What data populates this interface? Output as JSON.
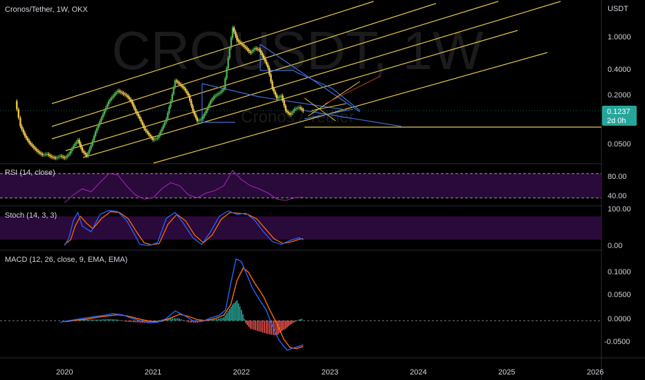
{
  "header": {
    "symbol_title": "Cronos/Tether, 1W, OKX",
    "currency": "USDT",
    "watermark_symbol": "CROUSDT, 1W",
    "watermark_name": "Cronos / Tether"
  },
  "colors": {
    "background": "#000000",
    "text": "#d1d4dc",
    "up": "#4caf50",
    "down": "#f2c94c",
    "channel": "#e6c84a",
    "wedge": "#3f6fd8",
    "rsi": "#9c27b0",
    "band_fill": "#2a0a3a",
    "macd": "#2962ff",
    "signal": "#ff6d00",
    "hist_pos": "#26a69a",
    "hist_neg": "#ef5350",
    "price_tag": "#26a69a",
    "accent_red": "#c0392b"
  },
  "chart_data": {
    "type": "candlestick",
    "timeframe": "1W",
    "exchange": "OKX",
    "x_axis": {
      "labels": [
        "2020",
        "2021",
        "2022",
        "2023",
        "2024",
        "2025",
        "2026"
      ],
      "range": [
        2019.27,
        2026.07
      ]
    },
    "price": {
      "scale": "log",
      "ylim": [
        0.036,
        1.5
      ],
      "tick_labels": [
        "1.0000",
        "0.4000",
        "0.2000",
        "0.0500"
      ],
      "last_price": "0.1237",
      "countdown": "2d 0h",
      "closes": [
        [
          2019.44,
          0.15
        ],
        [
          2019.5,
          0.085
        ],
        [
          2019.55,
          0.068
        ],
        [
          2019.6,
          0.058
        ],
        [
          2019.65,
          0.052
        ],
        [
          2019.7,
          0.047
        ],
        [
          2019.75,
          0.044
        ],
        [
          2019.8,
          0.045
        ],
        [
          2019.85,
          0.042
        ],
        [
          2019.9,
          0.041
        ],
        [
          2019.95,
          0.043
        ],
        [
          2020.0,
          0.041
        ],
        [
          2020.05,
          0.045
        ],
        [
          2020.1,
          0.054
        ],
        [
          2020.15,
          0.062
        ],
        [
          2020.2,
          0.048
        ],
        [
          2020.25,
          0.043
        ],
        [
          2020.3,
          0.055
        ],
        [
          2020.35,
          0.075
        ],
        [
          2020.4,
          0.095
        ],
        [
          2020.45,
          0.12
        ],
        [
          2020.5,
          0.15
        ],
        [
          2020.55,
          0.17
        ],
        [
          2020.6,
          0.19
        ],
        [
          2020.65,
          0.18
        ],
        [
          2020.7,
          0.17
        ],
        [
          2020.75,
          0.15
        ],
        [
          2020.8,
          0.12
        ],
        [
          2020.85,
          0.1
        ],
        [
          2020.9,
          0.08
        ],
        [
          2020.95,
          0.07
        ],
        [
          2021.0,
          0.062
        ],
        [
          2021.05,
          0.065
        ],
        [
          2021.1,
          0.08
        ],
        [
          2021.15,
          0.1
        ],
        [
          2021.2,
          0.15
        ],
        [
          2021.25,
          0.24
        ],
        [
          2021.3,
          0.22
        ],
        [
          2021.35,
          0.2
        ],
        [
          2021.4,
          0.17
        ],
        [
          2021.45,
          0.12
        ],
        [
          2021.5,
          0.095
        ],
        [
          2021.55,
          0.1
        ],
        [
          2021.6,
          0.12
        ],
        [
          2021.65,
          0.15
        ],
        [
          2021.7,
          0.17
        ],
        [
          2021.75,
          0.18
        ],
        [
          2021.8,
          0.2
        ],
        [
          2021.85,
          0.4
        ],
        [
          2021.9,
          0.8
        ],
        [
          2021.95,
          0.6
        ],
        [
          2022.0,
          0.55
        ],
        [
          2022.05,
          0.5
        ],
        [
          2022.1,
          0.45
        ],
        [
          2022.15,
          0.5
        ],
        [
          2022.2,
          0.48
        ],
        [
          2022.25,
          0.4
        ],
        [
          2022.3,
          0.32
        ],
        [
          2022.35,
          0.2
        ],
        [
          2022.4,
          0.16
        ],
        [
          2022.45,
          0.17
        ],
        [
          2022.5,
          0.12
        ],
        [
          2022.55,
          0.11
        ],
        [
          2022.6,
          0.125
        ],
        [
          2022.65,
          0.13
        ],
        [
          2022.7,
          0.12
        ]
      ]
    },
    "rsi": {
      "label": "RSI (14, close)",
      "band": [
        40,
        80
      ],
      "ylim": [
        28,
        95
      ],
      "tick_labels": [
        "80.00",
        "40.00"
      ],
      "values": [
        [
          2020.0,
          32
        ],
        [
          2020.1,
          45
        ],
        [
          2020.2,
          55
        ],
        [
          2020.3,
          50
        ],
        [
          2020.4,
          65
        ],
        [
          2020.5,
          80
        ],
        [
          2020.6,
          78
        ],
        [
          2020.7,
          60
        ],
        [
          2020.8,
          45
        ],
        [
          2020.9,
          38
        ],
        [
          2021.0,
          40
        ],
        [
          2021.1,
          55
        ],
        [
          2021.2,
          65
        ],
        [
          2021.3,
          60
        ],
        [
          2021.4,
          45
        ],
        [
          2021.5,
          40
        ],
        [
          2021.6,
          48
        ],
        [
          2021.7,
          52
        ],
        [
          2021.8,
          60
        ],
        [
          2021.9,
          85
        ],
        [
          2022.0,
          70
        ],
        [
          2022.1,
          60
        ],
        [
          2022.2,
          55
        ],
        [
          2022.3,
          48
        ],
        [
          2022.4,
          38
        ],
        [
          2022.5,
          36
        ],
        [
          2022.6,
          40
        ],
        [
          2022.7,
          41
        ]
      ]
    },
    "stoch": {
      "label": "Stoch (14, 3, 3)",
      "band": [
        20,
        80
      ],
      "ylim": [
        -5,
        105
      ],
      "tick_labels": [
        "100.00",
        "0.00"
      ],
      "k": [
        [
          2020.0,
          5
        ],
        [
          2020.05,
          25
        ],
        [
          2020.1,
          70
        ],
        [
          2020.15,
          90
        ],
        [
          2020.2,
          55
        ],
        [
          2020.3,
          40
        ],
        [
          2020.4,
          85
        ],
        [
          2020.5,
          95
        ],
        [
          2020.6,
          92
        ],
        [
          2020.7,
          70
        ],
        [
          2020.8,
          30
        ],
        [
          2020.85,
          8
        ],
        [
          2020.95,
          5
        ],
        [
          2021.05,
          12
        ],
        [
          2021.15,
          75
        ],
        [
          2021.25,
          90
        ],
        [
          2021.35,
          60
        ],
        [
          2021.45,
          25
        ],
        [
          2021.55,
          8
        ],
        [
          2021.65,
          40
        ],
        [
          2021.75,
          80
        ],
        [
          2021.85,
          94
        ],
        [
          2021.95,
          85
        ],
        [
          2022.05,
          88
        ],
        [
          2022.15,
          70
        ],
        [
          2022.25,
          40
        ],
        [
          2022.35,
          15
        ],
        [
          2022.45,
          8
        ],
        [
          2022.55,
          18
        ],
        [
          2022.65,
          25
        ],
        [
          2022.7,
          20
        ]
      ],
      "d": [
        [
          2020.0,
          8
        ],
        [
          2020.07,
          20
        ],
        [
          2020.12,
          55
        ],
        [
          2020.18,
          80
        ],
        [
          2020.25,
          62
        ],
        [
          2020.32,
          48
        ],
        [
          2020.42,
          75
        ],
        [
          2020.52,
          92
        ],
        [
          2020.62,
          90
        ],
        [
          2020.72,
          74
        ],
        [
          2020.82,
          38
        ],
        [
          2020.9,
          12
        ],
        [
          2020.98,
          7
        ],
        [
          2021.07,
          10
        ],
        [
          2021.17,
          60
        ],
        [
          2021.27,
          85
        ],
        [
          2021.37,
          68
        ],
        [
          2021.47,
          32
        ],
        [
          2021.57,
          12
        ],
        [
          2021.67,
          32
        ],
        [
          2021.77,
          72
        ],
        [
          2021.87,
          90
        ],
        [
          2021.97,
          88
        ],
        [
          2022.07,
          85
        ],
        [
          2022.17,
          74
        ],
        [
          2022.27,
          48
        ],
        [
          2022.37,
          22
        ],
        [
          2022.47,
          10
        ],
        [
          2022.57,
          15
        ],
        [
          2022.67,
          22
        ],
        [
          2022.7,
          22
        ]
      ]
    },
    "macd": {
      "label": "MACD (12, 26, close, 9, EMA, EMA)",
      "ylim": [
        -0.068,
        0.13
      ],
      "tick_labels": [
        "0.1000",
        "0.0500",
        "0.0000",
        "-0.0500"
      ],
      "macd": [
        [
          2019.95,
          -0.003
        ],
        [
          2020.05,
          0.0
        ],
        [
          2020.2,
          0.004
        ],
        [
          2020.35,
          0.008
        ],
        [
          2020.45,
          0.01
        ],
        [
          2020.55,
          0.013
        ],
        [
          2020.65,
          0.011
        ],
        [
          2020.75,
          0.005
        ],
        [
          2020.85,
          0.0
        ],
        [
          2020.95,
          -0.004
        ],
        [
          2021.05,
          -0.003
        ],
        [
          2021.15,
          0.004
        ],
        [
          2021.25,
          0.018
        ],
        [
          2021.35,
          0.01
        ],
        [
          2021.45,
          0.0
        ],
        [
          2021.55,
          -0.002
        ],
        [
          2021.65,
          0.005
        ],
        [
          2021.75,
          0.01
        ],
        [
          2021.82,
          0.02
        ],
        [
          2021.88,
          0.07
        ],
        [
          2021.94,
          0.115
        ],
        [
          2022.0,
          0.11
        ],
        [
          2022.05,
          0.09
        ],
        [
          2022.12,
          0.062
        ],
        [
          2022.2,
          0.04
        ],
        [
          2022.28,
          0.02
        ],
        [
          2022.35,
          -0.01
        ],
        [
          2022.42,
          -0.035
        ],
        [
          2022.48,
          -0.048
        ],
        [
          2022.52,
          -0.055
        ],
        [
          2022.6,
          -0.05
        ],
        [
          2022.7,
          -0.045
        ]
      ],
      "signal": [
        [
          2020.0,
          -0.002
        ],
        [
          2020.1,
          0.0
        ],
        [
          2020.25,
          0.003
        ],
        [
          2020.4,
          0.007
        ],
        [
          2020.5,
          0.009
        ],
        [
          2020.6,
          0.011
        ],
        [
          2020.7,
          0.009
        ],
        [
          2020.8,
          0.005
        ],
        [
          2020.9,
          0.001
        ],
        [
          2021.0,
          -0.002
        ],
        [
          2021.1,
          -0.001
        ],
        [
          2021.2,
          0.005
        ],
        [
          2021.3,
          0.012
        ],
        [
          2021.4,
          0.008
        ],
        [
          2021.5,
          0.002
        ],
        [
          2021.6,
          0.0
        ],
        [
          2021.7,
          0.004
        ],
        [
          2021.8,
          0.01
        ],
        [
          2021.88,
          0.03
        ],
        [
          2021.95,
          0.075
        ],
        [
          2022.02,
          0.098
        ],
        [
          2022.08,
          0.09
        ],
        [
          2022.15,
          0.07
        ],
        [
          2022.25,
          0.045
        ],
        [
          2022.32,
          0.02
        ],
        [
          2022.4,
          -0.005
        ],
        [
          2022.48,
          -0.035
        ],
        [
          2022.55,
          -0.05
        ],
        [
          2022.62,
          -0.052
        ],
        [
          2022.7,
          -0.048
        ]
      ],
      "histogram": [
        [
          2020.1,
          0.001
        ],
        [
          2020.2,
          0.002
        ],
        [
          2020.3,
          0.002
        ],
        [
          2020.4,
          0.002
        ],
        [
          2020.5,
          0.003
        ],
        [
          2020.6,
          0.002
        ],
        [
          2020.7,
          -0.002
        ],
        [
          2020.8,
          -0.003
        ],
        [
          2020.9,
          -0.004
        ],
        [
          2021.0,
          -0.002
        ],
        [
          2021.1,
          0.002
        ],
        [
          2021.2,
          0.005
        ],
        [
          2021.3,
          0.004
        ],
        [
          2021.4,
          -0.003
        ],
        [
          2021.5,
          -0.004
        ],
        [
          2021.6,
          0.002
        ],
        [
          2021.7,
          0.003
        ],
        [
          2021.8,
          0.006
        ],
        [
          2021.85,
          0.018
        ],
        [
          2021.9,
          0.03
        ],
        [
          2021.95,
          0.038
        ],
        [
          2022.0,
          0.02
        ],
        [
          2022.05,
          -0.005
        ],
        [
          2022.1,
          -0.015
        ],
        [
          2022.2,
          -0.02
        ],
        [
          2022.3,
          -0.025
        ],
        [
          2022.4,
          -0.028
        ],
        [
          2022.45,
          -0.02
        ],
        [
          2022.5,
          -0.015
        ],
        [
          2022.55,
          -0.008
        ],
        [
          2022.6,
          -0.003
        ],
        [
          2022.65,
          0.002
        ],
        [
          2022.7,
          0.004
        ]
      ]
    }
  }
}
